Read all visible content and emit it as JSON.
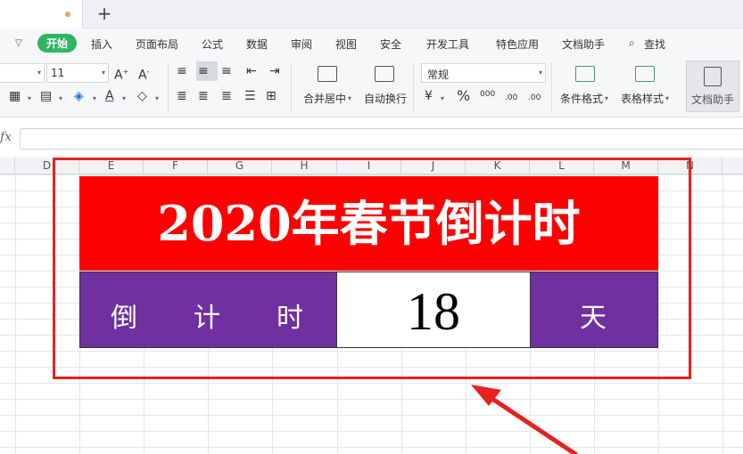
{
  "menu": {
    "items": [
      "开始",
      "插入",
      "页面布局",
      "公式",
      "数据",
      "审阅",
      "视图",
      "安全",
      "开发工具",
      "特色应用",
      "文档助手",
      "查找"
    ]
  },
  "ribbon": {
    "font_size": "11",
    "number_format": "常规",
    "merge_label": "合并居中",
    "wrap_label": "自动换行",
    "cond_format_label": "条件格式",
    "table_style_label": "表格样式",
    "assistant_label": "文档助手",
    "percent": "%",
    "thousands": "000",
    "inc_decimal": ".00",
    "dec_decimal": ".00"
  },
  "formula_bar": {
    "fx": "fx",
    "value": ""
  },
  "columns": [
    "D",
    "E",
    "F",
    "G",
    "H",
    "I",
    "J",
    "K",
    "L",
    "M",
    "N"
  ],
  "countdown": {
    "title": "2020年春节倒计时",
    "label_chars": [
      "倒",
      "计",
      "时"
    ],
    "days": "18",
    "unit": "天"
  },
  "colors": {
    "title_bg": "#fd0000",
    "label_bg": "#7030a0",
    "accent_green": "#2fb563",
    "annotation_red": "#e8201e"
  }
}
